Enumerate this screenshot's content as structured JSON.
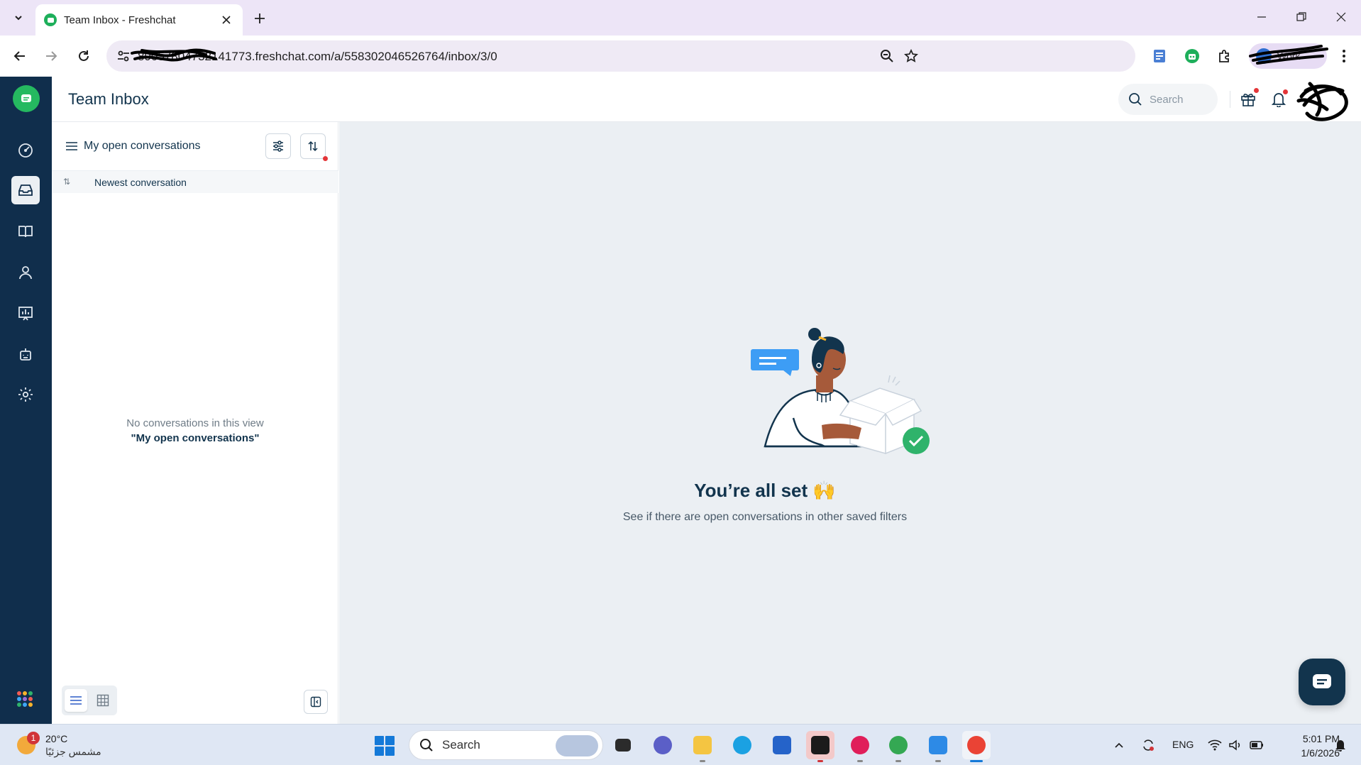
{
  "browser": {
    "tab_title": "Team Inbox - Freshchat",
    "url": "89057804732141773.freshchat.com/a/558302046526764/inbox/3/0",
    "profile_label": "Work"
  },
  "app": {
    "page_title": "Team Inbox",
    "search_placeholder": "Search",
    "left_nav": [
      "dashboard-icon",
      "inbox-icon",
      "book-icon",
      "contacts-icon",
      "reports-icon",
      "bot-icon",
      "settings-icon"
    ]
  },
  "conversation_list": {
    "view_title": "My open conversations",
    "sort_label": "Newest conversation",
    "empty_line1": "No conversations in this view",
    "empty_line2": "\"My open conversations\""
  },
  "main": {
    "empty_title": "You’re all set 🙌",
    "empty_subtitle": "See if there are open conversations in other saved filters"
  },
  "taskbar": {
    "weather_temp": "20°C",
    "weather_desc": "مشمس جزئيًا",
    "weather_badge": "1",
    "search_label": "Search",
    "language": "ENG",
    "time": "5:01 PM",
    "date": "1/6/2026"
  },
  "colors": {
    "nav_bg": "#102e4c",
    "brand_green": "#25b960",
    "pane_bg": "#ebeff3",
    "tab_bar": "#ede5f7"
  }
}
